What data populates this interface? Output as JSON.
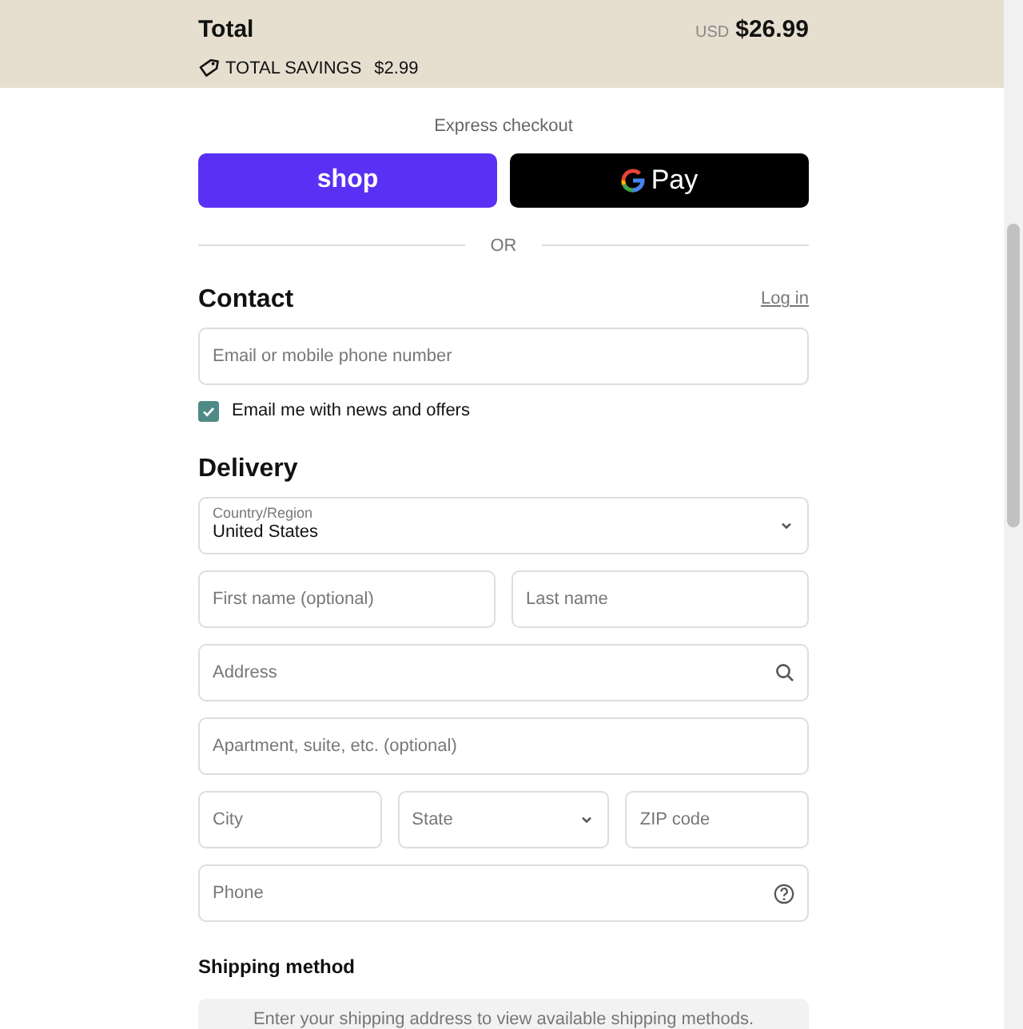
{
  "summary": {
    "label": "Total",
    "currency": "USD",
    "amount": "$26.99",
    "savings_label": "TOTAL SAVINGS",
    "savings_amount": "$2.99"
  },
  "express": {
    "title": "Express checkout",
    "buttons": [
      {
        "kind": "shop",
        "label": "shop"
      },
      {
        "kind": "gpay",
        "label": "Pay"
      }
    ],
    "divider": "OR"
  },
  "contact": {
    "title": "Contact",
    "login_link": "Log in",
    "email": {
      "placeholder": "Email or mobile phone number"
    },
    "newsletter": {
      "label": "Email me with news and offers",
      "checked": true
    }
  },
  "delivery": {
    "title": "Delivery",
    "rows": [
      [
        {
          "kind": "select",
          "label": "Country/Region",
          "value": "United States"
        }
      ],
      [
        {
          "kind": "text",
          "placeholder": "First name (optional)"
        },
        {
          "kind": "text",
          "placeholder": "Last name"
        }
      ],
      [
        {
          "kind": "search",
          "placeholder": "Address"
        }
      ],
      [
        {
          "kind": "text",
          "placeholder": "Apartment, suite, etc. (optional)"
        }
      ],
      [
        {
          "kind": "text",
          "placeholder": "City"
        },
        {
          "kind": "select",
          "placeholder": "State"
        },
        {
          "kind": "text",
          "placeholder": "ZIP code"
        }
      ],
      [
        {
          "kind": "help",
          "placeholder": "Phone"
        }
      ]
    ]
  },
  "shipping": {
    "title": "Shipping method",
    "message": "Enter your shipping address to view available shipping methods."
  }
}
